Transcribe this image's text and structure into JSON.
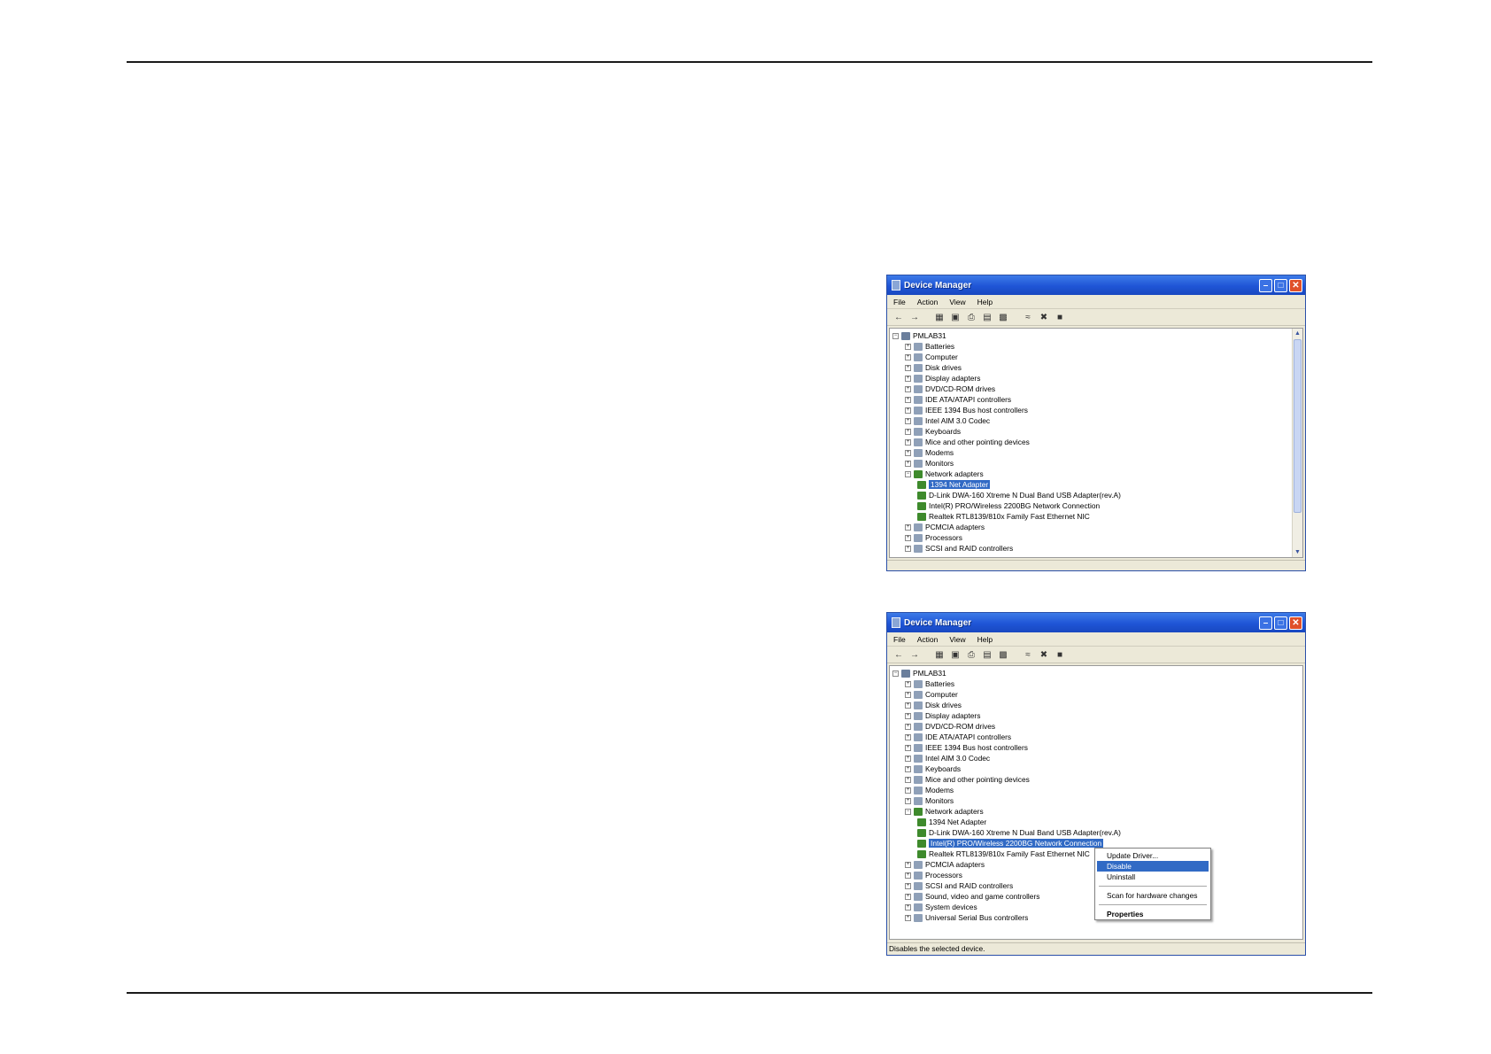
{
  "window1": {
    "title": "Device Manager",
    "menu": [
      "File",
      "Action",
      "View",
      "Help"
    ],
    "tree": {
      "root": "PMLAB31",
      "categories_before": [
        "Batteries",
        "Computer",
        "Disk drives",
        "Display adapters",
        "DVD/CD-ROM drives",
        "IDE ATA/ATAPI controllers",
        "IEEE 1394 Bus host controllers",
        "Intel AIM 3.0 Codec",
        "Keyboards",
        "Mice and other pointing devices",
        "Modems",
        "Monitors"
      ],
      "network_category": "Network adapters",
      "network_items": [
        "1394 Net Adapter",
        "D-Link DWA-160 Xtreme N Dual Band USB Adapter(rev.A)",
        "Intel(R) PRO/Wireless 2200BG Network Connection",
        "Realtek RTL8139/810x Family Fast Ethernet NIC"
      ],
      "selected_index": 0,
      "categories_after": [
        "PCMCIA adapters",
        "Processors",
        "SCSI and RAID controllers"
      ]
    },
    "status": ""
  },
  "window2": {
    "title": "Device Manager",
    "menu": [
      "File",
      "Action",
      "View",
      "Help"
    ],
    "tree": {
      "root": "PMLAB31",
      "categories_before": [
        "Batteries",
        "Computer",
        "Disk drives",
        "Display adapters",
        "DVD/CD-ROM drives",
        "IDE ATA/ATAPI controllers",
        "IEEE 1394 Bus host controllers",
        "Intel AIM 3.0 Codec",
        "Keyboards",
        "Mice and other pointing devices",
        "Modems",
        "Monitors"
      ],
      "network_category": "Network adapters",
      "network_items": [
        "1394 Net Adapter",
        "D-Link DWA-160 Xtreme N Dual Band USB Adapter(rev.A)",
        "Intel(R) PRO/Wireless 2200BG Network Connection",
        "Realtek RTL8139/810x Family Fast Ethernet NIC"
      ],
      "selected_index": 2,
      "categories_after": [
        "PCMCIA adapters",
        "Processors",
        "SCSI and RAID controllers",
        "Sound, video and game controllers",
        "System devices",
        "Universal Serial Bus controllers"
      ]
    },
    "context_menu": {
      "items": [
        "Update Driver...",
        "Disable",
        "Uninstall",
        "Scan for hardware changes",
        "Properties"
      ],
      "highlighted": "Disable"
    },
    "status": "Disables the selected device."
  },
  "colors": {
    "title_bar": "#1f55d6",
    "selection": "#316ac5",
    "window_face": "#ece9d8"
  }
}
